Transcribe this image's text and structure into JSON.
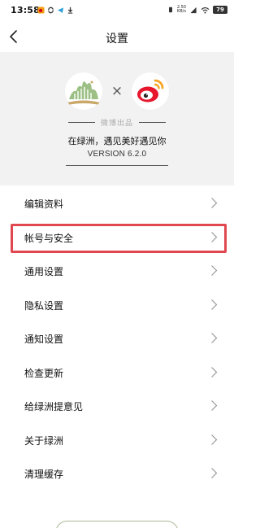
{
  "status_bar": {
    "time": "13:58",
    "left_icons": [
      "weibo-notification-icon",
      "sync-icon",
      "telegram-icon",
      "download-icon"
    ],
    "net_speed_value": "2.50",
    "net_speed_unit": "KB/s",
    "battery": "79"
  },
  "nav": {
    "title": "设置",
    "back_icon": "chevron-left-icon"
  },
  "hero": {
    "times_symbol": "×",
    "made_by": "微博出品",
    "slogan": "在绿洲，遇见美好遇见你",
    "version": "VERSION 6.2.0",
    "logos": [
      "oasis-logo",
      "weibo-logo"
    ]
  },
  "menu": {
    "items": [
      {
        "label": "编辑资料"
      },
      {
        "label": "帐号与安全"
      },
      {
        "label": "通用设置"
      },
      {
        "label": "隐私设置"
      },
      {
        "label": "通知设置"
      },
      {
        "label": "检查更新"
      },
      {
        "label": "给绿洲提意见"
      },
      {
        "label": "关于绿洲"
      },
      {
        "label": "清理缓存"
      }
    ],
    "highlighted_index": 1,
    "chevron_icon": "chevron-right-icon"
  },
  "colors": {
    "highlight": "#e0474f",
    "hero_background": "#f2f2f2",
    "oasis_green": "#8fb27a",
    "weibo_red": "#e6162d",
    "weibo_orange": "#f5a623"
  }
}
